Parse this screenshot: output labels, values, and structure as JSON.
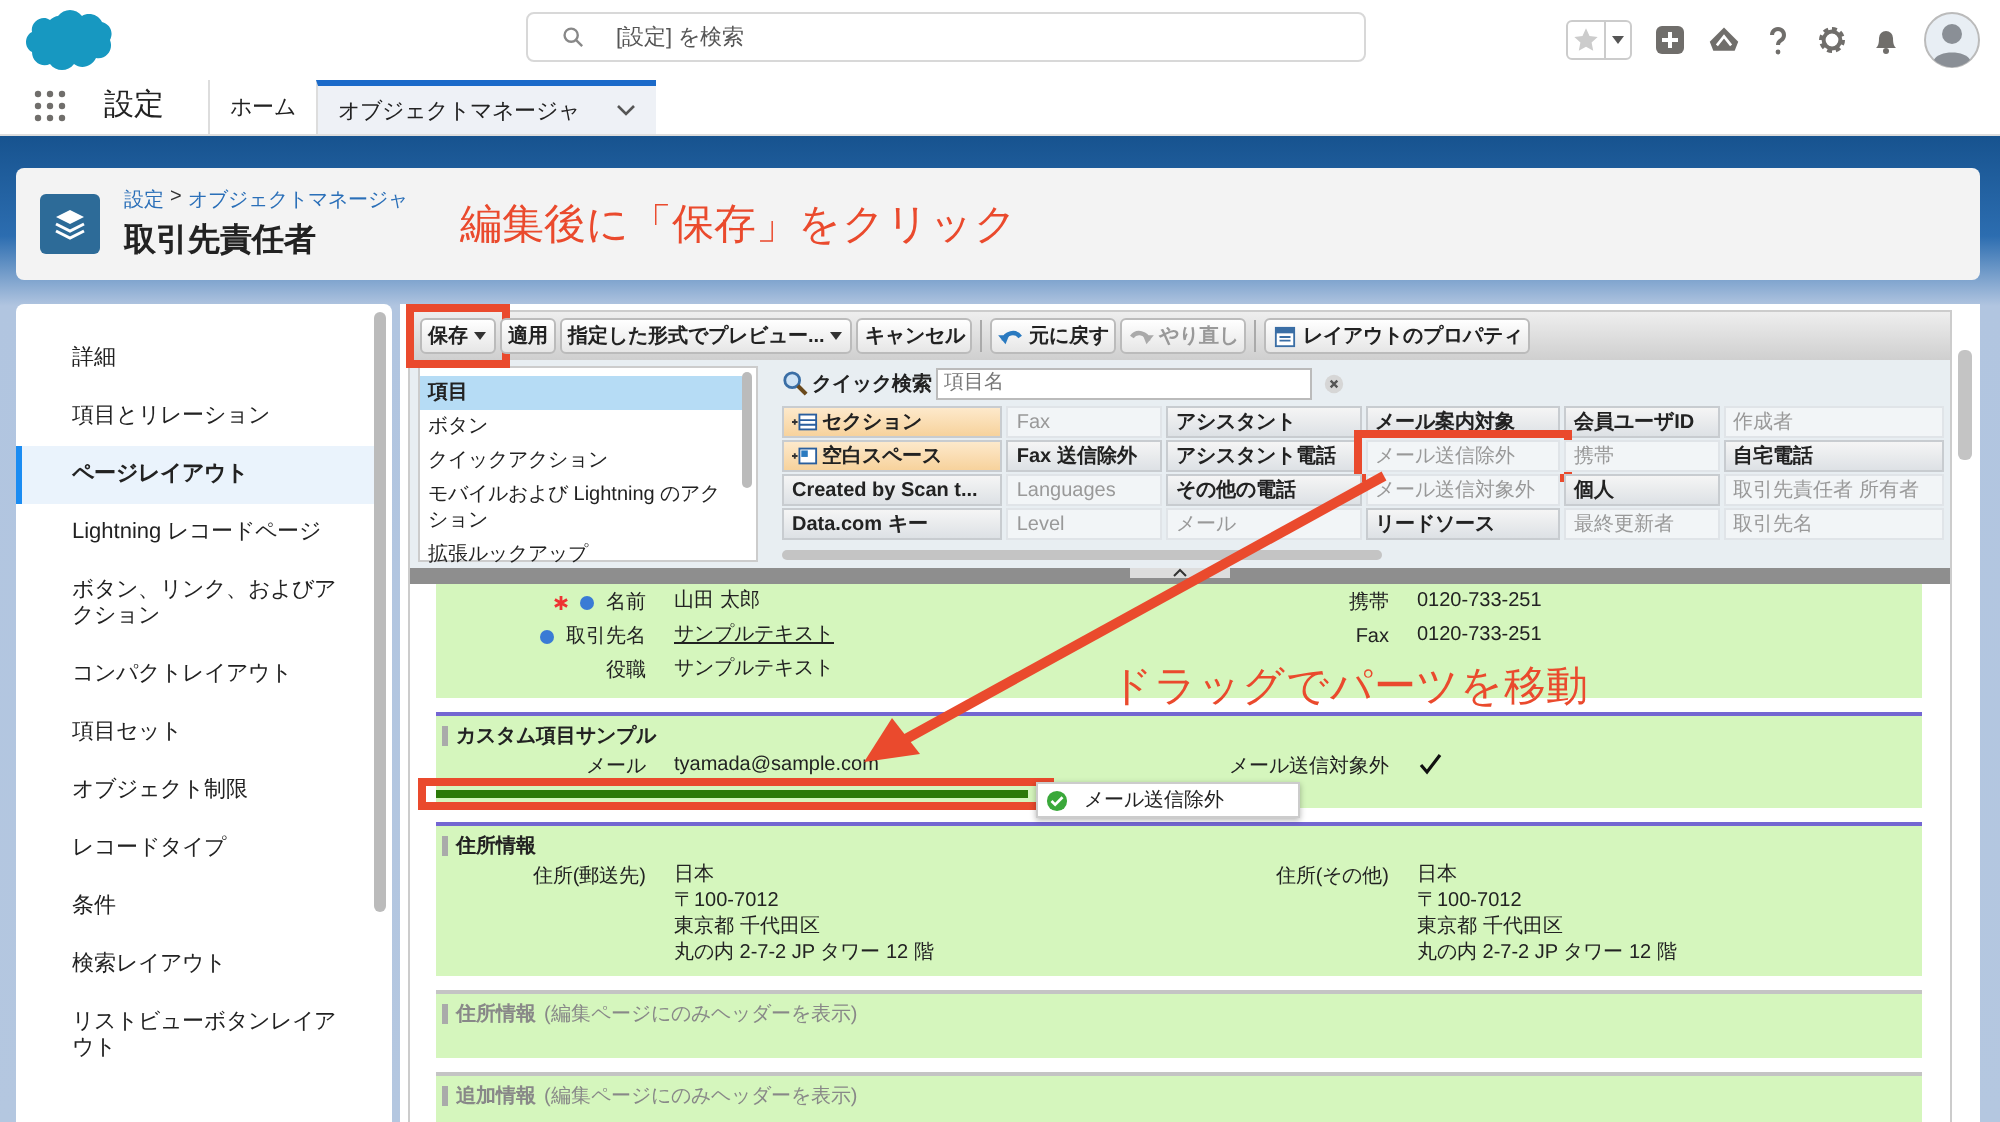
{
  "header": {
    "search": {
      "placeholder": "[設定] を検索"
    }
  },
  "nav": {
    "app_name": "設定",
    "tabs": [
      {
        "label": "ホーム",
        "selected": false
      },
      {
        "label": "オブジェクトマネージャ",
        "selected": true
      }
    ]
  },
  "page_header": {
    "breadcrumb": [
      {
        "label": "設定"
      },
      {
        "label": "オブジェクトマネージャ"
      }
    ],
    "separator": ">",
    "title": "取引先責任者"
  },
  "annotations": [
    "編集後に「保存」をクリック",
    "ドラッグでパーツを移動"
  ],
  "sidebar": {
    "items": [
      {
        "label": "詳細",
        "selected": false
      },
      {
        "label": "項目とリレーション",
        "selected": false
      },
      {
        "label": "ページレイアウト",
        "selected": true
      },
      {
        "label": "Lightning レコードページ",
        "selected": false
      },
      {
        "label": "ボタン、リンク、およびアクション",
        "selected": false
      },
      {
        "label": "コンパクトレイアウト",
        "selected": false
      },
      {
        "label": "項目セット",
        "selected": false
      },
      {
        "label": "オブジェクト制限",
        "selected": false
      },
      {
        "label": "レコードタイプ",
        "selected": false
      },
      {
        "label": "条件",
        "selected": false
      },
      {
        "label": "検索レイアウト",
        "selected": false
      },
      {
        "label": "リストビューボタンレイアウト",
        "selected": false
      }
    ]
  },
  "toolbar": {
    "buttons": [
      {
        "label": "保存",
        "kind": "dropdown",
        "disabled": false,
        "highlighted": true
      },
      {
        "label": "適用",
        "kind": "plain",
        "disabled": false,
        "highlighted": false
      },
      {
        "label": "指定した形式でプレビュー...",
        "kind": "dropdown",
        "disabled": false,
        "highlighted": false
      },
      {
        "label": "キャンセル",
        "kind": "plain",
        "disabled": false,
        "highlighted": false
      },
      {
        "label": "元に戻す",
        "kind": "undo",
        "disabled": false,
        "highlighted": false
      },
      {
        "label": "やり直し",
        "kind": "redo",
        "disabled": true,
        "highlighted": false
      },
      {
        "label": "レイアウトのプロパティ",
        "kind": "properties",
        "disabled": false,
        "highlighted": false
      }
    ]
  },
  "palette": {
    "categories": [
      {
        "label": "項目",
        "selected": true
      },
      {
        "label": "ボタン",
        "selected": false
      },
      {
        "label": "クイックアクション",
        "selected": false
      },
      {
        "label": "モバイルおよび Lightning のアクション",
        "selected": false
      },
      {
        "label": "拡張ルックアップ",
        "selected": false
      }
    ],
    "search": {
      "label": "クイック検索",
      "placeholder": "項目名"
    },
    "rows": [
      [
        {
          "label": "セクション",
          "kind": "section",
          "used": false,
          "highlighted": false
        },
        {
          "label": "Fax",
          "kind": "field",
          "used": true,
          "highlighted": false
        },
        {
          "label": "アシスタント",
          "kind": "field",
          "used": false,
          "highlighted": false
        },
        {
          "label": "メール案内対象",
          "kind": "field",
          "used": false,
          "highlighted": false
        },
        {
          "label": "会員ユーザID",
          "kind": "field",
          "used": false,
          "highlighted": false
        },
        {
          "label": "作成者",
          "kind": "field",
          "used": true,
          "highlighted": false
        }
      ],
      [
        {
          "label": "空白スペース",
          "kind": "space",
          "used": false,
          "highlighted": false
        },
        {
          "label": "Fax 送信除外",
          "kind": "field",
          "used": false,
          "highlighted": false
        },
        {
          "label": "アシスタント電話",
          "kind": "field",
          "used": false,
          "highlighted": false
        },
        {
          "label": "メール送信除外",
          "kind": "field",
          "used": true,
          "highlighted": true
        },
        {
          "label": "携帯",
          "kind": "field",
          "used": true,
          "highlighted": false
        },
        {
          "label": "自宅電話",
          "kind": "field",
          "used": false,
          "highlighted": false
        }
      ],
      [
        {
          "label": "Created by Scan t...",
          "kind": "field",
          "used": false,
          "highlighted": false
        },
        {
          "label": "Languages",
          "kind": "field",
          "used": true,
          "highlighted": false
        },
        {
          "label": "その他の電話",
          "kind": "field",
          "used": false,
          "highlighted": false
        },
        {
          "label": "メール送信対象外",
          "kind": "field",
          "used": true,
          "highlighted": false
        },
        {
          "label": "個人",
          "kind": "field",
          "used": false,
          "highlighted": false
        },
        {
          "label": "取引先責任者 所有者",
          "kind": "field",
          "used": true,
          "highlighted": false
        }
      ],
      [
        {
          "label": "Data.com キー",
          "kind": "field",
          "used": false,
          "highlighted": false
        },
        {
          "label": "Level",
          "kind": "field",
          "used": true,
          "highlighted": false
        },
        {
          "label": "メール",
          "kind": "field",
          "used": true,
          "highlighted": false
        },
        {
          "label": "リードソース",
          "kind": "field",
          "used": false,
          "highlighted": false
        },
        {
          "label": "最終更新者",
          "kind": "field",
          "used": true,
          "highlighted": false
        },
        {
          "label": "取引先名",
          "kind": "field",
          "used": true,
          "highlighted": false
        }
      ]
    ]
  },
  "layout": {
    "sections": [
      {
        "muted": false,
        "drop_indicator": false,
        "left": [
          {
            "label": "名前",
            "kind": "text",
            "required": true,
            "locked": true,
            "value": "山田 太郎"
          },
          {
            "label": "取引先名",
            "kind": "lookup",
            "required": false,
            "locked": true,
            "value": "サンプルテキスト"
          },
          {
            "label": "役職",
            "kind": "text",
            "required": false,
            "locked": false,
            "value": "サンプルテキスト"
          }
        ],
        "right": [
          {
            "label": "携帯",
            "kind": "text",
            "required": false,
            "locked": false,
            "value": "0120-733-251"
          },
          {
            "label": "Fax",
            "kind": "text",
            "required": false,
            "locked": false,
            "value": "0120-733-251"
          }
        ]
      },
      {
        "title": "カスタム項目サンプル",
        "muted": false,
        "drop_indicator": true,
        "left": [
          {
            "label": "メール",
            "kind": "text",
            "required": false,
            "locked": false,
            "value": "tyamada@sample.com"
          }
        ],
        "right": [
          {
            "label": "メール送信対象外",
            "kind": "checkbox",
            "required": false,
            "locked": false,
            "checked": true
          }
        ]
      },
      {
        "title": "住所情報",
        "muted": false,
        "drop_indicator": false,
        "left": [
          {
            "label": "住所(郵送先)",
            "kind": "address",
            "required": false,
            "locked": false,
            "lines": [
              "日本",
              "〒100-7012",
              "東京都 千代田区",
              "丸の内 2-7-2 JP タワー 12 階"
            ]
          }
        ],
        "right": [
          {
            "label": "住所(その他)",
            "kind": "address",
            "required": false,
            "locked": false,
            "lines": [
              "日本",
              "〒100-7012",
              "東京都 千代田区",
              "丸の内 2-7-2 JP タワー 12 階"
            ]
          }
        ]
      },
      {
        "title": "住所情報",
        "note": "(編集ページにのみヘッダーを表示)",
        "muted": true,
        "drop_indicator": false
      },
      {
        "title": "追加情報",
        "note": "(編集ページにのみヘッダーを表示)",
        "muted": true,
        "drop_indicator": false
      }
    ],
    "drag_item": {
      "label": "メール送信除外"
    }
  }
}
